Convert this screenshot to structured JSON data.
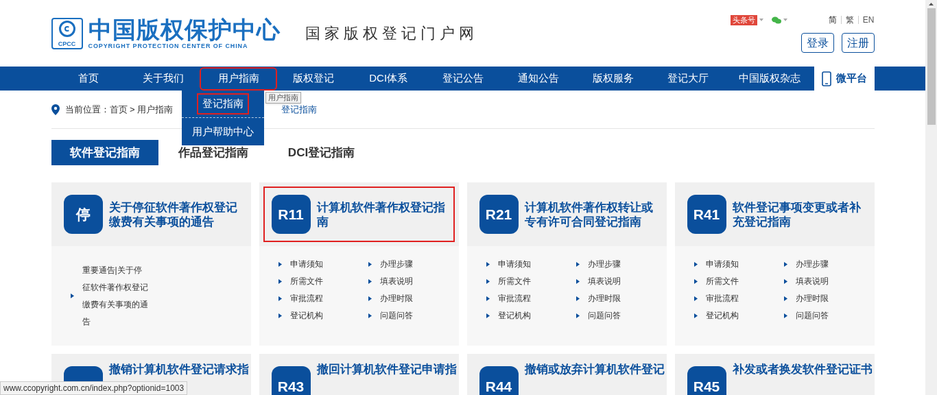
{
  "header": {
    "logo_mark": "CPCC",
    "logo_title": "中国版权保护中心",
    "logo_subtitle": "COPYRIGHT PROTECTION CENTER OF CHINA",
    "slogan": "国家版权登记门户网",
    "toutiao": "头条号",
    "languages": [
      {
        "label": "简",
        "selected": true
      },
      {
        "label": "繁",
        "selected": false
      },
      {
        "label": "EN",
        "selected": false
      }
    ],
    "buttons": [
      "登录",
      "注册"
    ]
  },
  "nav": {
    "items": [
      {
        "label": "首页",
        "highlighted": false
      },
      {
        "label": "关于我们",
        "highlighted": false
      },
      {
        "label": "用户指南",
        "highlighted": true
      },
      {
        "label": "版权登记",
        "highlighted": false
      },
      {
        "label": "DCI体系",
        "highlighted": false
      },
      {
        "label": "登记公告",
        "highlighted": false
      },
      {
        "label": "通知公告",
        "highlighted": false
      },
      {
        "label": "版权服务",
        "highlighted": false
      },
      {
        "label": "登记大厅",
        "highlighted": false
      },
      {
        "label": "中国版权杂志",
        "highlighted": false
      }
    ],
    "micro": "微平台",
    "dropdown": [
      {
        "label": "登记指南",
        "highlighted": true
      },
      {
        "label": "用户帮助中心",
        "highlighted": false
      }
    ],
    "tooltip": "用户指南"
  },
  "breadcrumb": {
    "prefix": "当前位置：首页 > 用户指南",
    "tail": "登记指南"
  },
  "tabs": [
    {
      "label": "软件登记指南",
      "selected": true
    },
    {
      "label": "作品登记指南",
      "selected": false
    },
    {
      "label": "DCI登记指南",
      "selected": false
    }
  ],
  "cards": [
    {
      "code": "停",
      "title": "关于停征软件著作权登记缴费有关事项的通告",
      "highlighted": false,
      "kind": "notice",
      "notice": "重要通告|关于停征软件著作权登记缴费有关事项的通告"
    },
    {
      "code": "R11",
      "title": "计算机软件著作权登记指南",
      "highlighted": true,
      "kind": "links",
      "links": [
        "申请须知",
        "办理步骤",
        "所需文件",
        "填表说明",
        "审批流程",
        "办理时限",
        "登记机构",
        "问题问答"
      ]
    },
    {
      "code": "R21",
      "title": "计算机软件著作权转让或专有许可合同登记指南",
      "highlighted": false,
      "kind": "links",
      "links": [
        "申请须知",
        "办理步骤",
        "所需文件",
        "填表说明",
        "审批流程",
        "办理时限",
        "登记机构",
        "问题问答"
      ]
    },
    {
      "code": "R41",
      "title": "软件登记事项变更或者补充登记指南",
      "highlighted": false,
      "kind": "links",
      "links": [
        "申请须知",
        "办理步骤",
        "所需文件",
        "填表说明",
        "审批流程",
        "办理时限",
        "登记机构",
        "问题问答"
      ]
    }
  ],
  "more_cards": [
    {
      "title": "撤销计算机软件登记请求指"
    },
    {
      "code": "R43",
      "title": "撤回计算机软件登记申请指"
    },
    {
      "code": "R44",
      "title": "撤销或放弃计算机软件登记"
    },
    {
      "code": "R45",
      "title": "补发或者换发软件登记证书"
    }
  ],
  "status_bar": "www.ccopyright.com.cn/index.php?optionid=1003"
}
